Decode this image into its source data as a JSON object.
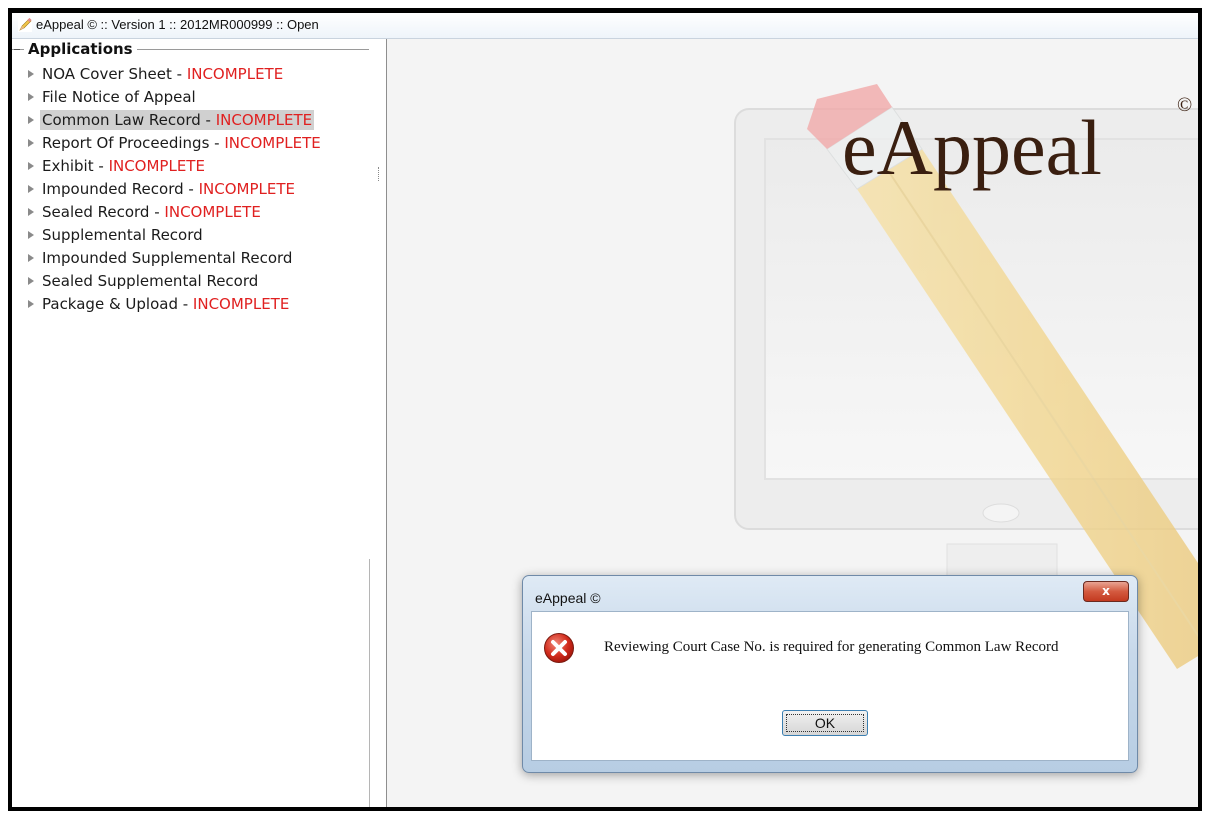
{
  "window": {
    "title": "eAppeal © :: Version 1 :: 2012MR000999 :: Open",
    "icon": "pencil-app-icon"
  },
  "sidebar": {
    "group_title": "Applications",
    "items": [
      {
        "label": "NOA Cover Sheet",
        "separator": " - ",
        "status": "INCOMPLETE",
        "selected": false
      },
      {
        "label": "File Notice of Appeal",
        "separator": "",
        "status": "",
        "selected": false
      },
      {
        "label": "Common Law Record",
        "separator": " - ",
        "status": "INCOMPLETE",
        "selected": true
      },
      {
        "label": "Report Of Proceedings",
        "separator": " - ",
        "status": "INCOMPLETE",
        "selected": false
      },
      {
        "label": "Exhibit",
        "separator": " - ",
        "status": "INCOMPLETE",
        "selected": false
      },
      {
        "label": "Impounded Record",
        "separator": " - ",
        "status": "INCOMPLETE",
        "selected": false
      },
      {
        "label": "Sealed Record",
        "separator": " - ",
        "status": "INCOMPLETE",
        "selected": false
      },
      {
        "label": "Supplemental Record",
        "separator": "",
        "status": "",
        "selected": false
      },
      {
        "label": "Impounded Supplemental Record",
        "separator": "",
        "status": "",
        "selected": false
      },
      {
        "label": "Sealed Supplemental Record",
        "separator": "",
        "status": "",
        "selected": false
      },
      {
        "label": "Package & Upload",
        "separator": " - ",
        "status": "INCOMPLETE",
        "selected": false
      }
    ]
  },
  "splash": {
    "logo_text": "eAppeal",
    "logo_mark": "©"
  },
  "dialog": {
    "title": "eAppeal ©",
    "close_label": "x",
    "icon": "error-icon",
    "message": "Reviewing Court Case No. is required for generating Common Law Record",
    "ok_label": "OK"
  },
  "colors": {
    "status_incomplete": "#e02020",
    "selected_row": "#d0d0d0",
    "logo": "#3a1f10"
  }
}
